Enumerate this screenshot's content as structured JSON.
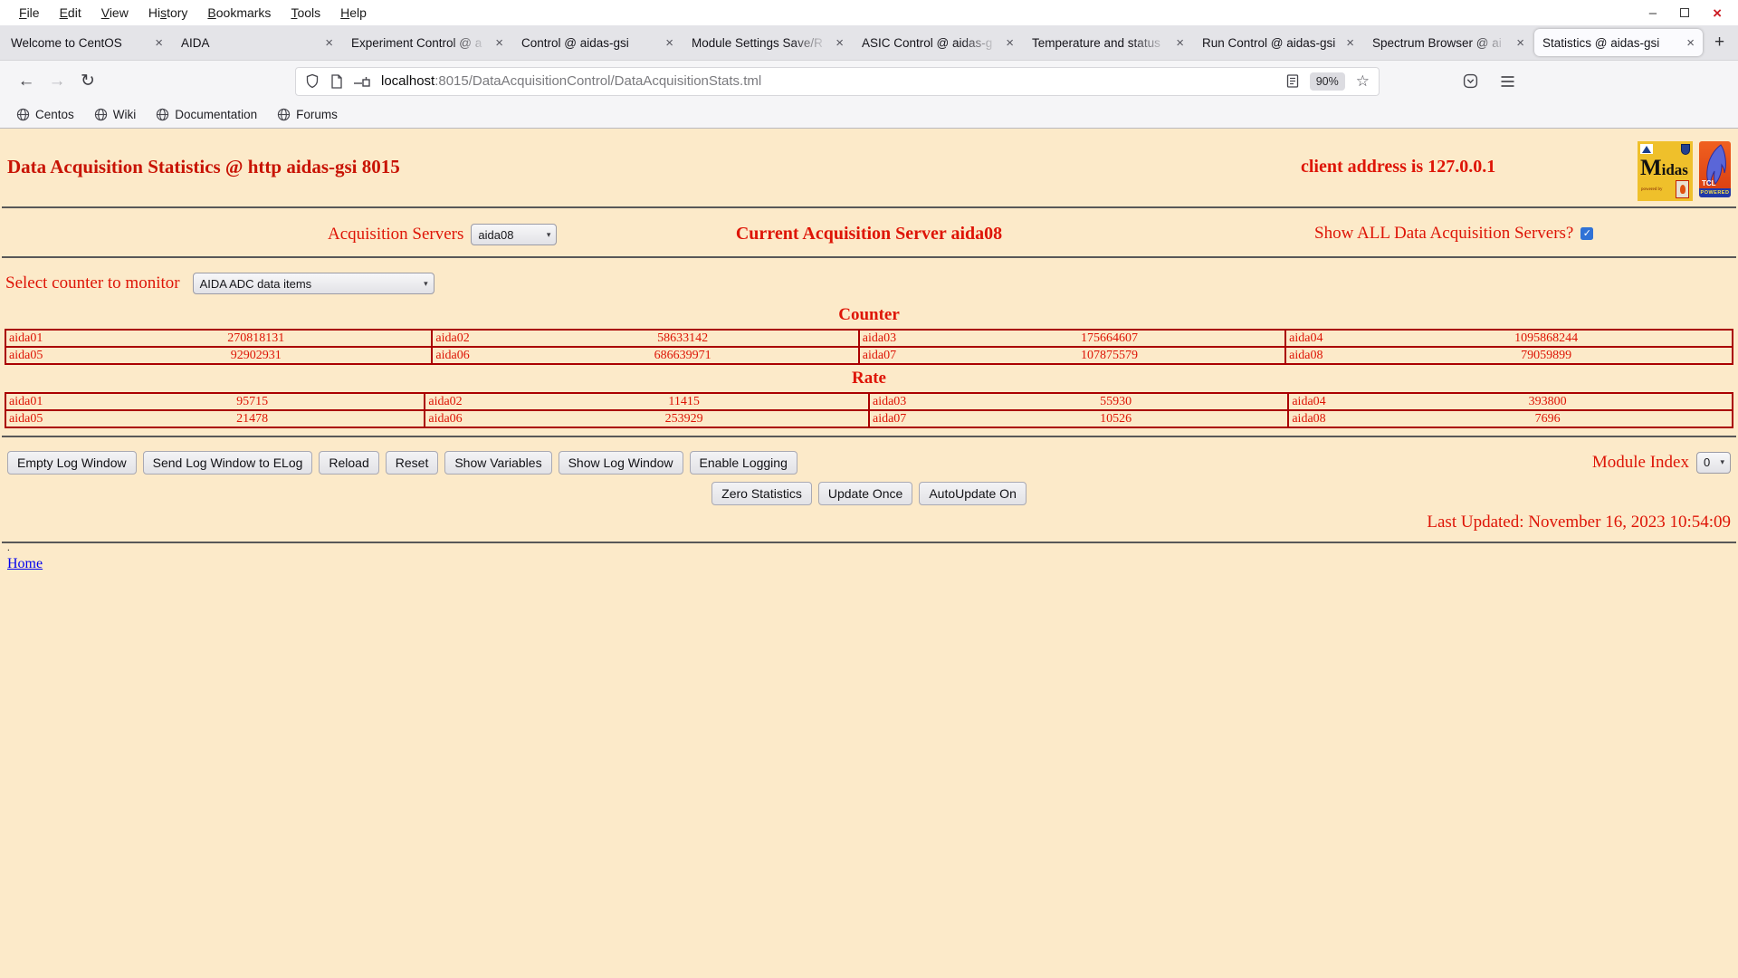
{
  "window": {
    "menu": [
      {
        "label": "File",
        "key": "F"
      },
      {
        "label": "Edit",
        "key": "E"
      },
      {
        "label": "View",
        "key": "V"
      },
      {
        "label": "History",
        "key": "s"
      },
      {
        "label": "Bookmarks",
        "key": "B"
      },
      {
        "label": "Tools",
        "key": "T"
      },
      {
        "label": "Help",
        "key": "H"
      }
    ],
    "controls": {
      "minimize": "‒",
      "close": "×"
    }
  },
  "tabs": [
    {
      "title": "Welcome to CentOS",
      "active": false
    },
    {
      "title": "AIDA",
      "active": false
    },
    {
      "title": "Experiment Control @ a",
      "active": false
    },
    {
      "title": "Control @ aidas-gsi",
      "active": false
    },
    {
      "title": "Module Settings Save/R",
      "active": false
    },
    {
      "title": "ASIC Control @ aidas-g",
      "active": false
    },
    {
      "title": "Temperature and status",
      "active": false
    },
    {
      "title": "Run Control @ aidas-gsi",
      "active": false
    },
    {
      "title": "Spectrum Browser @ ai",
      "active": false
    },
    {
      "title": "Statistics @ aidas-gsi",
      "active": true
    }
  ],
  "icons": {
    "back": "←",
    "forward": "→",
    "reload": "↻",
    "star": "☆",
    "new_tab": "+",
    "tab_close": "×",
    "chevron": "▾",
    "checkmark": "✓"
  },
  "toolbar": {
    "url_host": "localhost",
    "url_rest": ":8015/DataAcquisitionControl/DataAcquisitionStats.tml",
    "zoom_badge": "90%"
  },
  "bookmarks": [
    {
      "label": "Centos"
    },
    {
      "label": "Wiki"
    },
    {
      "label": "Documentation"
    },
    {
      "label": "Forums"
    }
  ],
  "page": {
    "title": "Data Acquisition Statistics @ http aidas-gsi 8015",
    "client_address": "client address is 127.0.0.1",
    "acquisition_servers_label": "Acquisition Servers",
    "acquisition_server_value": "aida08",
    "current_server_text": "Current Acquisition Server aida08",
    "show_all_label": "Show ALL Data Acquisition Servers?",
    "show_all_checked": true,
    "select_counter_label": "Select counter to monitor",
    "counter_select_value": "AIDA ADC data items",
    "counter_heading": "Counter",
    "rate_heading": "Rate",
    "counter": [
      [
        {
          "name": "aida01",
          "value": "270818131"
        },
        {
          "name": "aida02",
          "value": "58633142"
        },
        {
          "name": "aida03",
          "value": "175664607"
        },
        {
          "name": "aida04",
          "value": "1095868244"
        }
      ],
      [
        {
          "name": "aida05",
          "value": "92902931"
        },
        {
          "name": "aida06",
          "value": "686639971"
        },
        {
          "name": "aida07",
          "value": "107875579"
        },
        {
          "name": "aida08",
          "value": "79059899"
        }
      ]
    ],
    "rate": [
      [
        {
          "name": "aida01",
          "value": "95715"
        },
        {
          "name": "aida02",
          "value": "11415"
        },
        {
          "name": "aida03",
          "value": "55930"
        },
        {
          "name": "aida04",
          "value": "393800"
        }
      ],
      [
        {
          "name": "aida05",
          "value": "21478"
        },
        {
          "name": "aida06",
          "value": "253929"
        },
        {
          "name": "aida07",
          "value": "10526"
        },
        {
          "name": "aida08",
          "value": "7696"
        }
      ]
    ],
    "log_buttons": [
      "Empty Log Window",
      "Send Log Window to ELog",
      "Reload",
      "Reset",
      "Show Variables",
      "Show Log Window",
      "Enable Logging"
    ],
    "module_index_label": "Module Index",
    "module_index_value": "0",
    "action_buttons": [
      "Zero Statistics",
      "Update Once",
      "AutoUpdate On"
    ],
    "last_updated": "Last Updated: November 16, 2023 10:54:09",
    "footer_dot": ".",
    "home_link": "Home"
  },
  "logos": {
    "midas_text": "Midas",
    "midas_sub": "powered by",
    "tcl_text": "TCL",
    "tcl_sub": "POWERED"
  },
  "colors": {
    "page_bg": "#fceac9",
    "red_text": "#de1507",
    "red_border": "#aa0000",
    "link_blue": "#0000ee",
    "checkbox_blue": "#3072d6"
  }
}
